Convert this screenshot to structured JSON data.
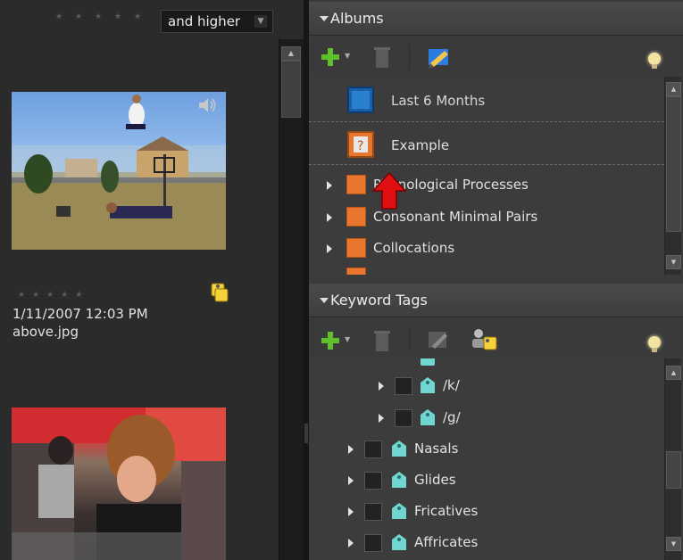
{
  "filter": {
    "rating_select": "and higher"
  },
  "photos": [
    {
      "name": "photo-jumping",
      "has_audio": true
    },
    {
      "name": "photo-cafe",
      "has_audio": false
    }
  ],
  "photo_meta": {
    "date": "1/11/2007 12:03 PM",
    "filename": "above.jpg"
  },
  "albums": {
    "title": "Albums",
    "items": [
      {
        "label": "Last 6 Months",
        "icon": "smart-album-icon"
      },
      {
        "label": "Example",
        "icon": "album-question-icon",
        "selected": true
      },
      {
        "label": "Phonological Processes",
        "icon": "album-icon",
        "expandable": true
      },
      {
        "label": "Consonant Minimal Pairs",
        "icon": "album-icon",
        "expandable": true
      },
      {
        "label": "Collocations",
        "icon": "album-icon",
        "expandable": true
      }
    ]
  },
  "keyword_tags": {
    "title": "Keyword Tags",
    "items": [
      {
        "label": "/k/",
        "level": 2
      },
      {
        "label": "/g/",
        "level": 2
      },
      {
        "label": "Nasals",
        "level": 1
      },
      {
        "label": "Glides",
        "level": 1
      },
      {
        "label": "Fricatives",
        "level": 1
      },
      {
        "label": "Affricates",
        "level": 1
      }
    ]
  },
  "colors": {
    "accent_green": "#5fbf2d",
    "album_orange": "#e8762c",
    "tag_teal": "#6fd6d0",
    "arrow_red": "#e01010"
  }
}
